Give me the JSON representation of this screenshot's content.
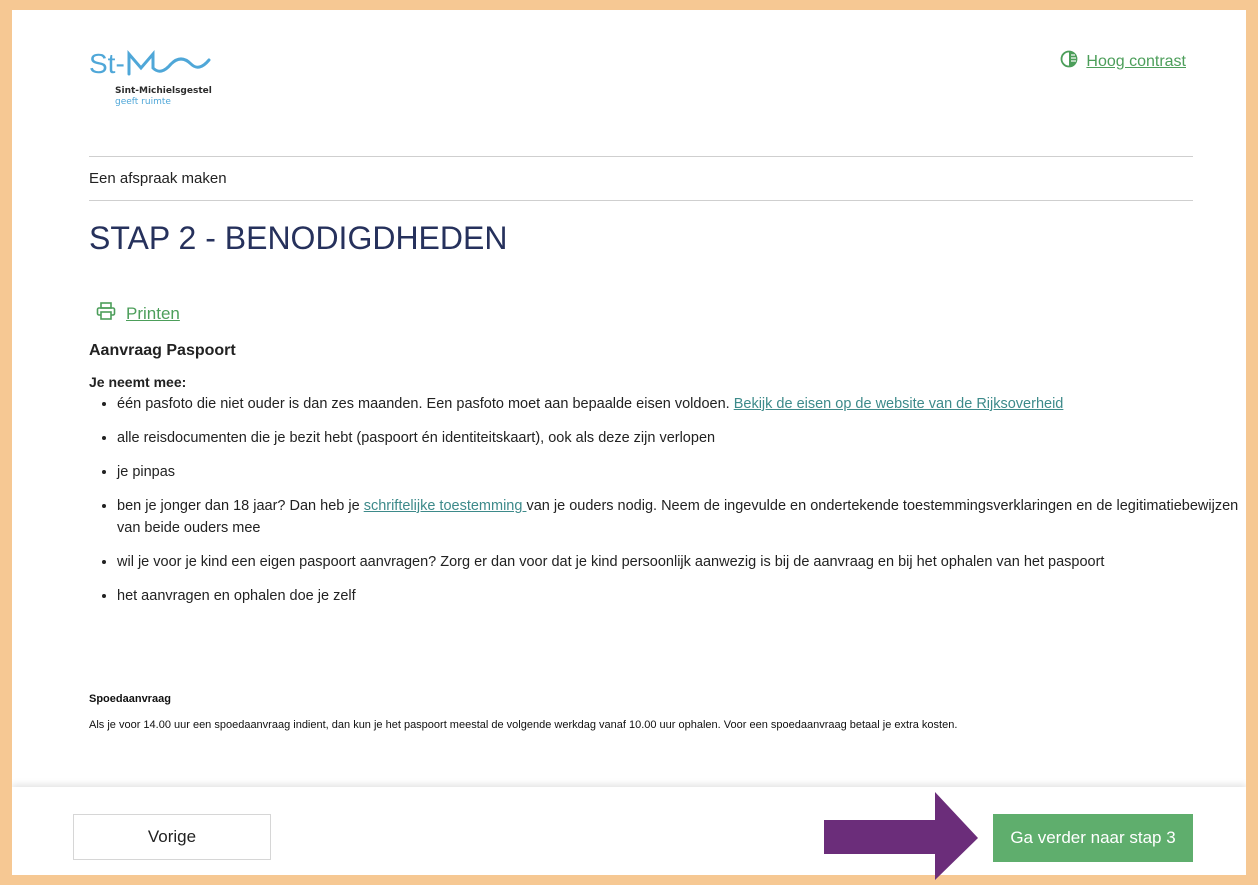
{
  "header": {
    "logo_text": "St-",
    "logo_name": "Sint-Michielsgestel",
    "logo_tagline": "geeft ruimte",
    "contrast_label": "Hoog contrast",
    "contrast_icon": "contrast-icon"
  },
  "breadcrumb": "Een afspraak maken",
  "title": "STAP 2 - BENODIGDHEDEN",
  "print": {
    "label": "Printen",
    "icon": "printer-icon"
  },
  "section_title": "Aanvraag Paspoort",
  "bring_label": "Je neemt mee:",
  "items": {
    "i0": {
      "text": "één pasfoto die niet ouder is dan zes maanden. Een pasfoto moet aan bepaalde eisen voldoen. ",
      "link": "Bekijk de eisen op de website van de Rijksoverheid"
    },
    "i1": {
      "text": "alle reisdocumenten die je bezit hebt (paspoort én identiteitskaart), ook als deze zijn verlopen"
    },
    "i2": {
      "text": "je pinpas"
    },
    "i3": {
      "before": "ben je jonger dan 18 jaar? Dan heb je ",
      "link": "schriftelijke toestemming ",
      "after": "van je ouders nodig.  Neem de ingevulde en ondertekende toestemmingsverklaringen en de legitimatiebewijzen van beide ouders mee"
    },
    "i4": {
      "text": "wil je voor je kind een eigen paspoort aanvragen? Zorg er dan voor dat je kind persoonlijk aanwezig is bij de aanvraag en bij het ophalen van het paspoort"
    },
    "i5": {
      "text": "het aanvragen en ophalen doe je zelf"
    }
  },
  "spoed": {
    "title": "Spoedaanvraag",
    "text": "Als je voor 14.00 uur een spoedaanvraag indient, dan kun je het paspoort meestal de volgende werkdag vanaf 10.00 uur ophalen. Voor een spoedaanvraag betaal je extra kosten."
  },
  "footer": {
    "prev_label": "Vorige",
    "next_label": "Ga verder naar stap 3"
  },
  "colors": {
    "accent_green": "#5fae6d",
    "title_navy": "#26315c",
    "border_orange": "#f6c893",
    "arrow_purple": "#6b2d7a"
  }
}
